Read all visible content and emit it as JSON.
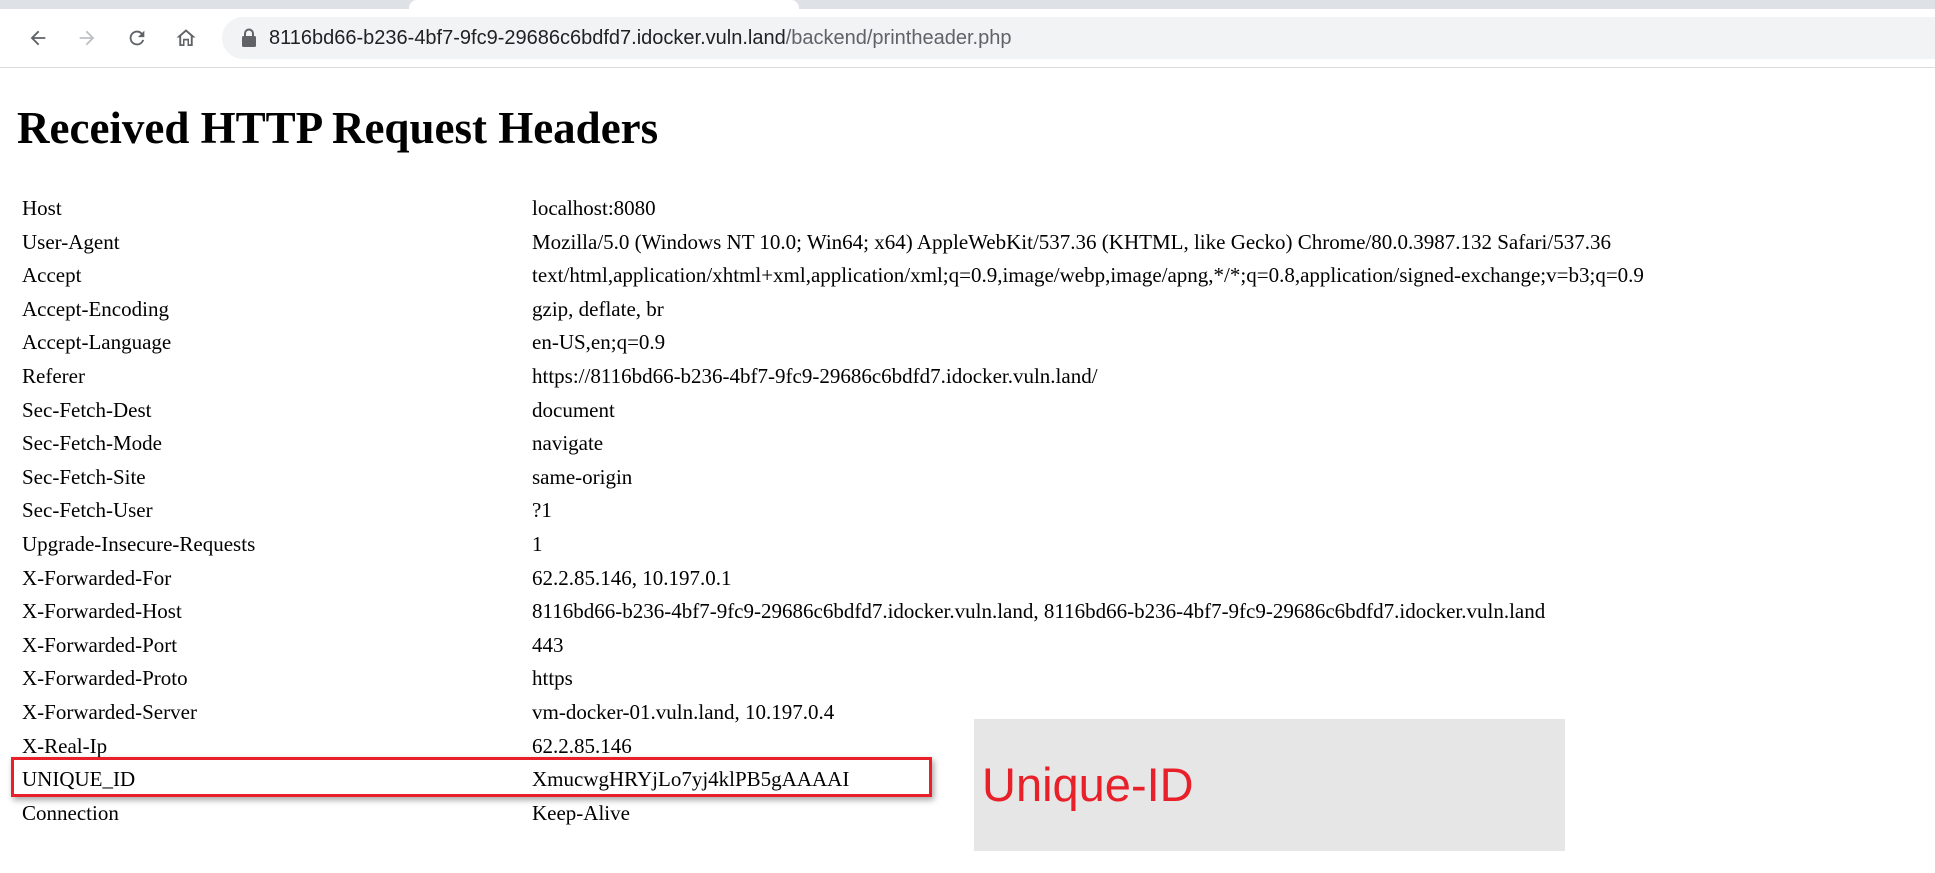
{
  "browser": {
    "url_host": "8116bd66-b236-4bf7-9fc9-29686c6bdfd7.idocker.vuln.land",
    "url_path": "/backend/printheader.php",
    "icons": {
      "back": "back-arrow-icon",
      "forward": "forward-arrow-icon",
      "reload": "reload-icon",
      "home": "home-icon",
      "lock": "lock-icon"
    }
  },
  "page": {
    "title": "Received HTTP Request Headers",
    "headers": [
      {
        "name": "Host",
        "value": "localhost:8080"
      },
      {
        "name": "User-Agent",
        "value": "Mozilla/5.0 (Windows NT 10.0; Win64; x64) AppleWebKit/537.36 (KHTML, like Gecko) Chrome/80.0.3987.132 Safari/537.36"
      },
      {
        "name": "Accept",
        "value": "text/html,application/xhtml+xml,application/xml;q=0.9,image/webp,image/apng,*/*;q=0.8,application/signed-exchange;v=b3;q=0.9"
      },
      {
        "name": "Accept-Encoding",
        "value": "gzip, deflate, br"
      },
      {
        "name": "Accept-Language",
        "value": "en-US,en;q=0.9"
      },
      {
        "name": "Referer",
        "value": "https://8116bd66-b236-4bf7-9fc9-29686c6bdfd7.idocker.vuln.land/"
      },
      {
        "name": "Sec-Fetch-Dest",
        "value": "document"
      },
      {
        "name": "Sec-Fetch-Mode",
        "value": "navigate"
      },
      {
        "name": "Sec-Fetch-Site",
        "value": "same-origin"
      },
      {
        "name": "Sec-Fetch-User",
        "value": "?1"
      },
      {
        "name": "Upgrade-Insecure-Requests",
        "value": "1"
      },
      {
        "name": "X-Forwarded-For",
        "value": "62.2.85.146, 10.197.0.1"
      },
      {
        "name": "X-Forwarded-Host",
        "value": "8116bd66-b236-4bf7-9fc9-29686c6bdfd7.idocker.vuln.land, 8116bd66-b236-4bf7-9fc9-29686c6bdfd7.idocker.vuln.land"
      },
      {
        "name": "X-Forwarded-Port",
        "value": "443"
      },
      {
        "name": "X-Forwarded-Proto",
        "value": "https"
      },
      {
        "name": "X-Forwarded-Server",
        "value": "vm-docker-01.vuln.land, 10.197.0.4"
      },
      {
        "name": "X-Real-Ip",
        "value": "62.2.85.146"
      },
      {
        "name": "UNIQUE_ID",
        "value": "XmucwgHRYjLo7yj4klPB5gAAAAI"
      },
      {
        "name": "Connection",
        "value": "Keep-Alive"
      }
    ]
  },
  "annotation": {
    "label": "Unique-ID",
    "color": "#e8202a",
    "highlighted_header": "UNIQUE_ID"
  }
}
